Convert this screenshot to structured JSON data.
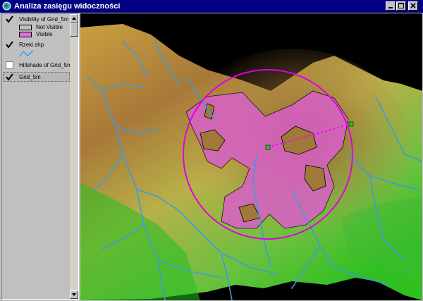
{
  "window": {
    "title": "Analiza zasięgu widoczności"
  },
  "toc": {
    "layers": [
      {
        "name": "Visibility of Grid_5m",
        "checked": true
      },
      {
        "name": "Rzeki.shp",
        "checked": true
      },
      {
        "name": "Hillshade of Grid_5m",
        "checked": false
      },
      {
        "name": "Grid_5m",
        "checked": true
      }
    ],
    "legend": [
      {
        "label": "Not Visible",
        "color": "#c0c0c0"
      },
      {
        "label": "Visible",
        "color": "#e070d8"
      }
    ]
  },
  "colors": {
    "titlebar": "#000080",
    "visible_area": "#e070d8",
    "range_circle": "#e000e0",
    "rivers": "#3c9be0",
    "observer_point": "#20d020"
  },
  "icons": [
    "app-globe-icon",
    "minimize-icon",
    "maximize-icon",
    "close-icon",
    "checkmark-icon",
    "scroll-up-icon",
    "scroll-down-icon",
    "river-line-icon"
  ]
}
